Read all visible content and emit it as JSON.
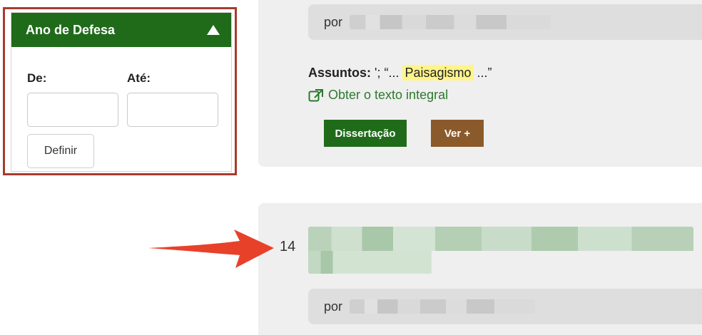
{
  "filter": {
    "title": "Ano de Defesa",
    "from_label": "De:",
    "to_label": "Até:",
    "from_value": "",
    "to_value": "",
    "define_label": "Definir"
  },
  "results": [
    {
      "author_prefix": "por",
      "subjects_label": "Assuntos:",
      "subjects_prefix": " '; “... ",
      "subjects_highlight": "Paisagismo",
      "subjects_suffix": " ...”",
      "fulltext_label": "Obter o texto integral",
      "type_tag": "Dissertação",
      "more_tag": "Ver +"
    },
    {
      "number": "14",
      "author_prefix": "por"
    }
  ],
  "colors": {
    "header_green": "#1f6b1a",
    "outline_red": "#a63b2f",
    "tag_brown": "#8b5a2b",
    "link_green": "#2c7a2c",
    "highlight_yellow": "#fff48a",
    "arrow_red": "#e8412a"
  }
}
